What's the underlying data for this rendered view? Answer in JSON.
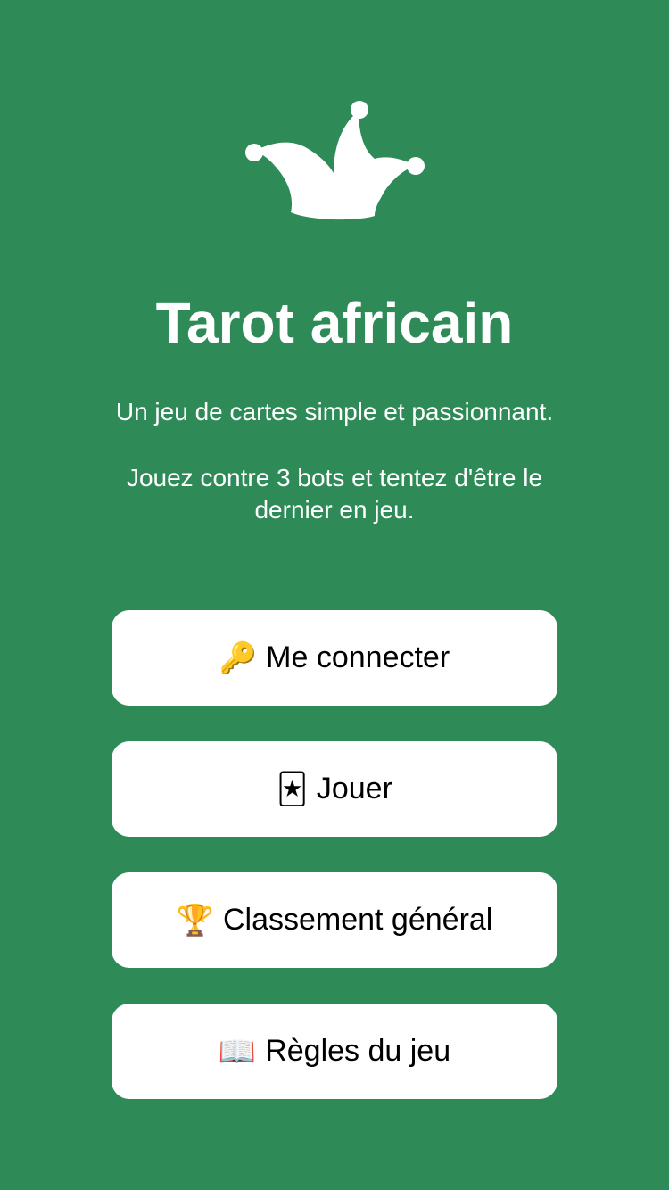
{
  "app": {
    "title": "Tarot africain",
    "tagline": "Un jeu de cartes simple et passionnant.",
    "description": "Jouez contre 3 bots et tentez d'être le dernier en jeu.",
    "logo_icon": "jester-hat-icon"
  },
  "menu": [
    {
      "icon": "key-icon",
      "emoji": "🔑",
      "label": "Me connecter"
    },
    {
      "icon": "joker-card-icon",
      "emoji": "🃏",
      "label": "Jouer"
    },
    {
      "icon": "trophy-icon",
      "emoji": "🏆",
      "label": "Classement général"
    },
    {
      "icon": "book-icon",
      "emoji": "📖",
      "label": "Règles du jeu"
    }
  ],
  "colors": {
    "background": "#2e8b57",
    "button_bg": "#ffffff",
    "button_text": "#000000",
    "title_text": "#ffffff"
  }
}
